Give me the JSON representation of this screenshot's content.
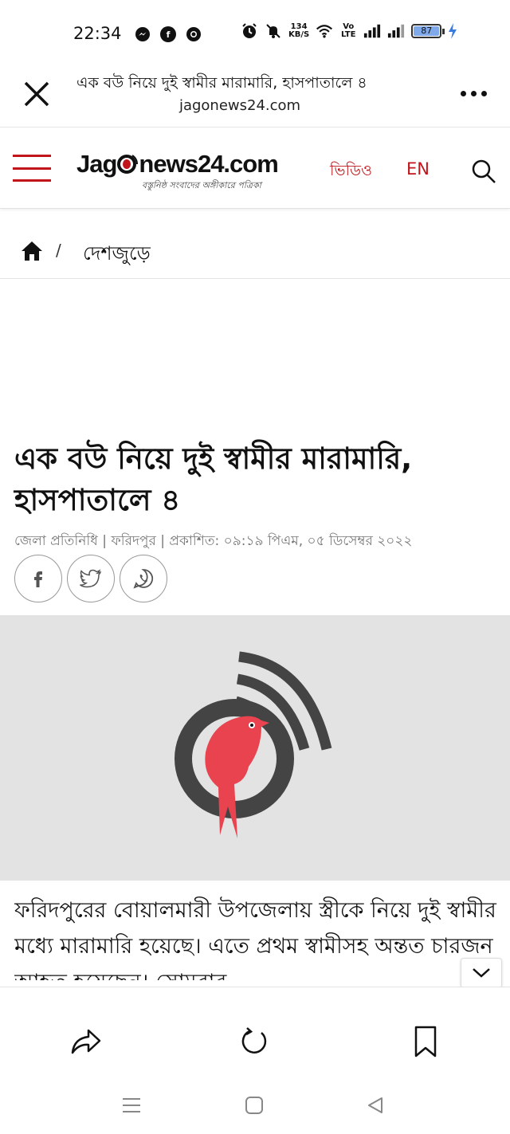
{
  "status_bar": {
    "time": "22:34",
    "net_speed_value": "134",
    "net_speed_unit": "KB/S",
    "volte_label": "Vo LTE",
    "battery_level": "87",
    "left_icons": [
      "messenger-icon",
      "facebook-icon",
      "chrome-icon"
    ],
    "right_icons": [
      "alarm-icon",
      "mute-icon",
      "wifi-icon",
      "volte-icon",
      "signal-icon",
      "signal-icon-2",
      "battery-icon",
      "charging-icon"
    ]
  },
  "browser": {
    "page_title": "এক বউ নিয়ে দুই স্বামীর মারামারি, হাসপাতালে ৪",
    "url": "jagonews24.com"
  },
  "site_header": {
    "logo_text_pre": "Jag",
    "logo_text_post": "news24.com",
    "logo_tagline": "বস্তুনিষ্ঠ সংবাদের অঙ্গীকারে পত্রিকা",
    "nav_video": "ভিডিও",
    "nav_en": "EN",
    "brand_color": "#c0151b"
  },
  "breadcrumb": {
    "separator": "/",
    "section": "দেশজুড়ে"
  },
  "article": {
    "headline": "এক বউ নিয়ে দুই স্বামীর মারামারি, হাসপাতালে ৪",
    "meta": "জেলা প্রতিনিধি | ফরিদপুর | প্রকাশিত: ০৯:১৯ পিএম, ০৫ ডিসেম্বর ২০২২",
    "share_icons": [
      "facebook-icon",
      "twitter-icon",
      "whatsapp-icon"
    ],
    "body": "ফরিদপুরের বোয়ালমারী উপজেলায় স্ত্রীকে নিয়ে দুই স্বামীর মধ্যে মারামারি হয়েছে। এতে প্রথম স্বামীসহ অন্তত চারজন আহত হয়েছেন। সোমবার"
  },
  "toolbar": {
    "icons": [
      "share-icon",
      "reload-icon",
      "bookmark-icon"
    ]
  },
  "nav_bar": {
    "icons": [
      "menu-icon",
      "home-icon",
      "back-icon"
    ]
  }
}
